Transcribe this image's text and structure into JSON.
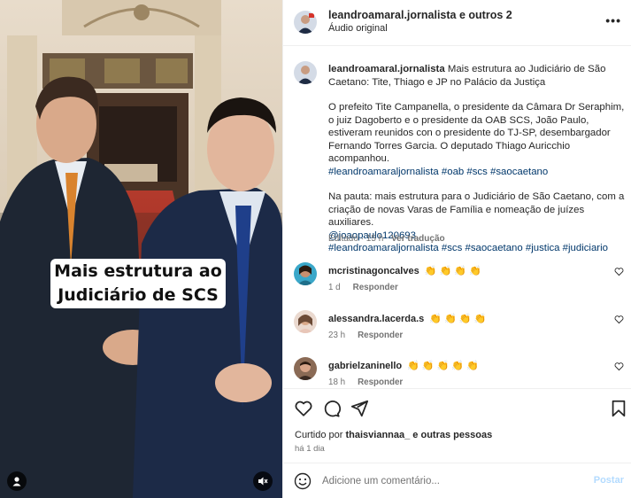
{
  "header": {
    "author_line": "leandroamaral.jornalista e outros 2",
    "audio": "Áudio original",
    "more_icon": "more-horizontal-icon"
  },
  "video": {
    "caption_line1": "Mais estrutura ao",
    "caption_line2": "Judiciário de SCS",
    "user_icon": "person-icon",
    "mute_icon": "speaker-muted-icon"
  },
  "post": {
    "username": "leandroamaral.jornalista",
    "title": "Mais estrutura ao Judiciário de São Caetano: Tite, Thiago e JP no Palácio da Justiça",
    "para1": "O prefeito Tite Campanella, o presidente da Câmara Dr Seraphim, o juiz Dagoberto e o presidente da OAB SCS, João Paulo, estiveram reunidos con o presidente do TJ-SP, desembargador Fernando Torres Garcia. O deputado Thiago Auricchio acompanhou.",
    "tags1": "#leandroamaraljornalista #oab #scs #saocaetano",
    "para2": "Na pauta: mais estrutura para o Judiciário de São Caetano, com a criação de novas Varas de Família e nomeação de juízes auxiliares.",
    "mention": "@joaopaulo120693",
    "tags2": "#leandroamaraljornalista #scs #saocaetano #justica #judiciario",
    "edited": "Editado · 15 h",
    "translate": "Ver tradução"
  },
  "comments": [
    {
      "user": "mcristinagoncalves",
      "text": "👏 👏 👏 👏",
      "time": "1 d",
      "reply": "Responder",
      "avatar_color": "#3aa7c9"
    },
    {
      "user": "alessandra.lacerda.s",
      "text": "👏 👏 👏 👏",
      "time": "23 h",
      "reply": "Responder",
      "avatar_color": "#d9b8a8"
    },
    {
      "user": "gabrielzaninello",
      "text": "👏 👏 👏 👏 👏",
      "time": "18 h",
      "reply": "Responder",
      "avatar_color": "#6b4a3a"
    }
  ],
  "actions": {
    "icons": [
      "heart-icon",
      "comment-icon",
      "share-icon",
      "bookmark-icon"
    ],
    "liked_prefix": "Curtido por ",
    "liked_user": "thaisviannaa_",
    "liked_suffix": " e outras pessoas",
    "ago": "há 1 dia"
  },
  "add_comment": {
    "placeholder": "Adicione um comentário...",
    "post_label": "Postar"
  },
  "colors": {
    "link": "#00376b",
    "muted": "#737373",
    "post_disabled": "#b3dbff"
  }
}
